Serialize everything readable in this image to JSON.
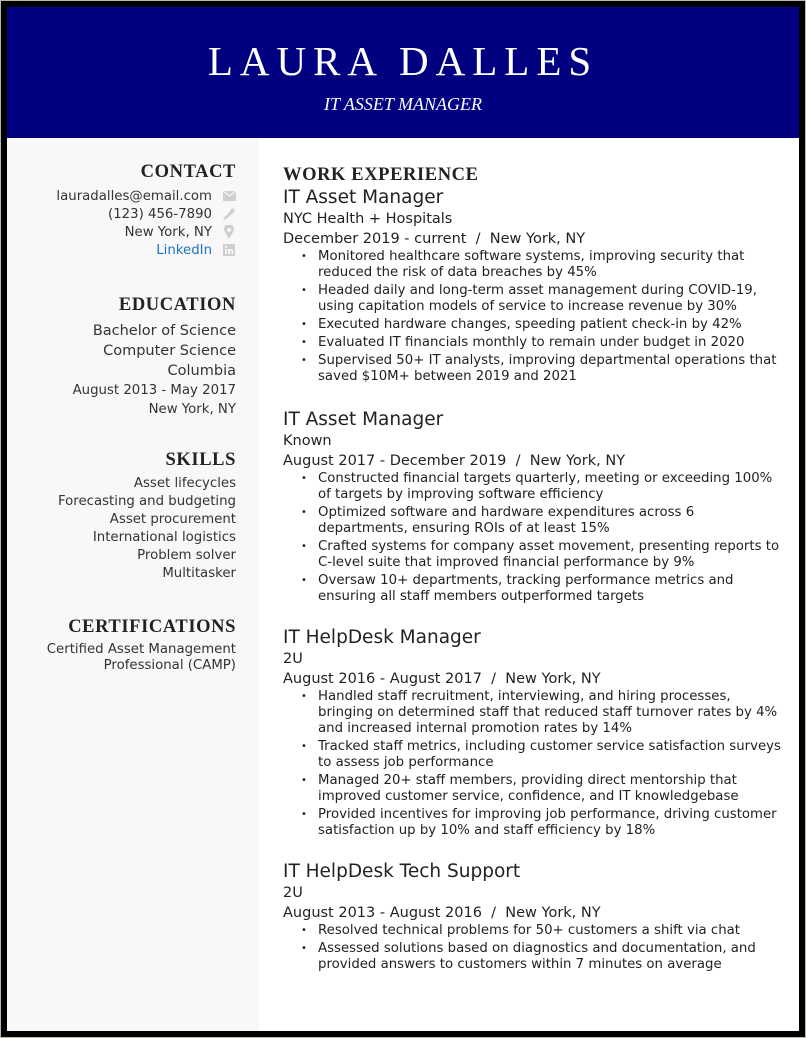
{
  "header": {
    "name": "LAURA DALLES",
    "title": "IT ASSET MANAGER",
    "background": "#000080"
  },
  "sidebar": {
    "contact": {
      "heading": "CONTACT",
      "email": "lauradalles@email.com",
      "phone": "(123) 456-7890",
      "location": "New York, NY",
      "linkedin": "LinkedIn",
      "icons": [
        "envelope-icon",
        "phone-icon",
        "map-pin-icon",
        "linkedin-icon"
      ]
    },
    "education": {
      "heading": "EDUCATION",
      "degree": "Bachelor of Science",
      "major": "Computer Science",
      "school": "Columbia",
      "dates": "August 2013 - May 2017",
      "location": "New York, NY"
    },
    "skills": {
      "heading": "SKILLS",
      "items": [
        "Asset lifecycles",
        "Forecasting and budgeting",
        "Asset procurement",
        "International logistics",
        "Problem solver",
        "Multitasker"
      ]
    },
    "certifications": {
      "heading": "CERTIFICATIONS",
      "line1": "Certified Asset Management",
      "line2": "Professional (CAMP)"
    }
  },
  "work": {
    "heading": "WORK EXPERIENCE",
    "jobs": [
      {
        "title": "IT Asset Manager",
        "company": "NYC Health + Hospitals",
        "dates": "December 2019 - current  /  New York, NY",
        "bullets": [
          "Monitored healthcare software systems, improving security that reduced the risk of data breaches by 45%",
          "Headed daily and long-term asset management during COVID-19, using capitation models of service to increase revenue by 30%",
          "Executed hardware changes, speeding patient check-in by 42%",
          "Evaluated IT financials monthly to remain under budget in 2020",
          "Supervised 50+ IT analysts, improving departmental operations that saved $10M+ between 2019 and 2021"
        ]
      },
      {
        "title": "IT Asset Manager",
        "company": "Known",
        "dates": "August 2017 - December 2019  /  New York, NY",
        "bullets": [
          "Constructed financial targets quarterly, meeting or exceeding 100% of targets by improving software efficiency",
          "Optimized software and hardware expenditures across 6 departments, ensuring ROIs of at least 15%",
          "Crafted systems for company asset movement, presenting reports to C-level suite that improved financial performance by 9%",
          "Oversaw 10+ departments, tracking performance metrics and ensuring all staff members outperformed targets"
        ]
      },
      {
        "title": "IT HelpDesk Manager",
        "company": "2U",
        "dates": "August 2016 - August 2017  /  New York, NY",
        "bullets": [
          "Handled staff recruitment, interviewing, and hiring processes, bringing on determined staff that reduced staff turnover rates by 4% and increased internal promotion rates by 14%",
          "Tracked staff metrics, including customer service satisfaction surveys to assess job performance",
          "Managed 20+ staff members, providing direct mentorship that improved customer service, confidence, and IT knowledgebase",
          "Provided incentives for improving job performance, driving customer satisfaction up by 10% and staff efficiency by 18%"
        ]
      },
      {
        "title": "IT HelpDesk Tech Support",
        "company": "2U",
        "dates": "August 2013 - August 2016  /  New York, NY",
        "bullets": [
          "Resolved technical problems for 50+ customers a shift via chat",
          "Assessed solutions based on diagnostics and documentation, and provided answers to customers within 7 minutes on average"
        ]
      }
    ]
  }
}
